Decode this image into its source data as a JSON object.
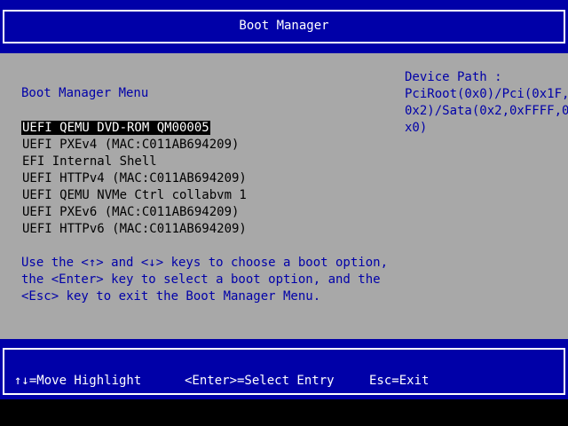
{
  "header": {
    "title": "Boot Manager"
  },
  "menu": {
    "title": "Boot Manager Menu",
    "items": [
      "UEFI QEMU DVD-ROM QM00005",
      "UEFI PXEv4 (MAC:C011AB694209)",
      "EFI Internal Shell",
      "UEFI HTTPv4 (MAC:C011AB694209)",
      "UEFI QEMU NVMe Ctrl collabvm 1",
      "UEFI PXEv6 (MAC:C011AB694209)",
      "UEFI HTTPv6 (MAC:C011AB694209)"
    ],
    "selected_index": 0
  },
  "help": {
    "line1": "Use the <↑> and <↓> keys to choose a boot option,",
    "line2": "the <Enter> key to select a boot option, and the",
    "line3": "<Esc> key to exit the Boot Manager Menu."
  },
  "device_path": {
    "label": "Device Path :",
    "line1": "PciRoot(0x0)/Pci(0x1F,",
    "line2": "0x2)/Sata(0x2,0xFFFF,0",
    "line3": "x0)"
  },
  "footer": {
    "move": "↑↓=Move Highlight",
    "select": "<Enter>=Select Entry",
    "exit": "Esc=Exit"
  },
  "colors": {
    "blue": "#0000a8",
    "gray": "#a8a8a8",
    "white": "#ffffff",
    "black": "#000000"
  }
}
